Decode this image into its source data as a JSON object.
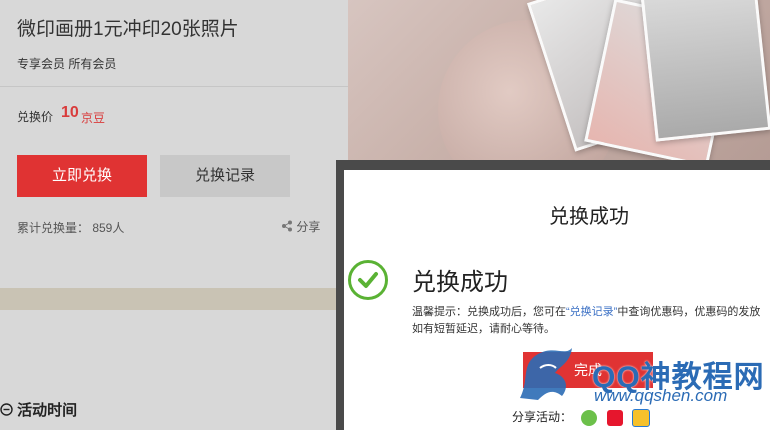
{
  "product": {
    "title": "微印画册1元冲印20张照片",
    "member": "专享会员   所有会员",
    "price_label": "兑换价",
    "price_value": "10",
    "price_unit": "京豆",
    "redeem_button": "立即兑换",
    "record_button": "兑换记录",
    "redeem_count": "累计兑换量：  859人",
    "share_label": "分享"
  },
  "section": {
    "activity_time": "活动时间"
  },
  "modal": {
    "title": "兑换成功",
    "success_text": "兑换成功",
    "tip_prefix": "温馨提示：兑换成功后，您可在",
    "tip_link": "“兑换记录”",
    "tip_suffix": "中查询优惠码，优惠码的发放如有短暂延迟，请耐心等待。",
    "done_button": "完成",
    "share_label": "分享活动："
  },
  "watermark": {
    "title": "QQ神教程网",
    "url": "www.qqshen.com"
  },
  "colors": {
    "primary_red": "#e03333",
    "success_green": "#5ab234",
    "link_blue": "#3a6fc4"
  }
}
